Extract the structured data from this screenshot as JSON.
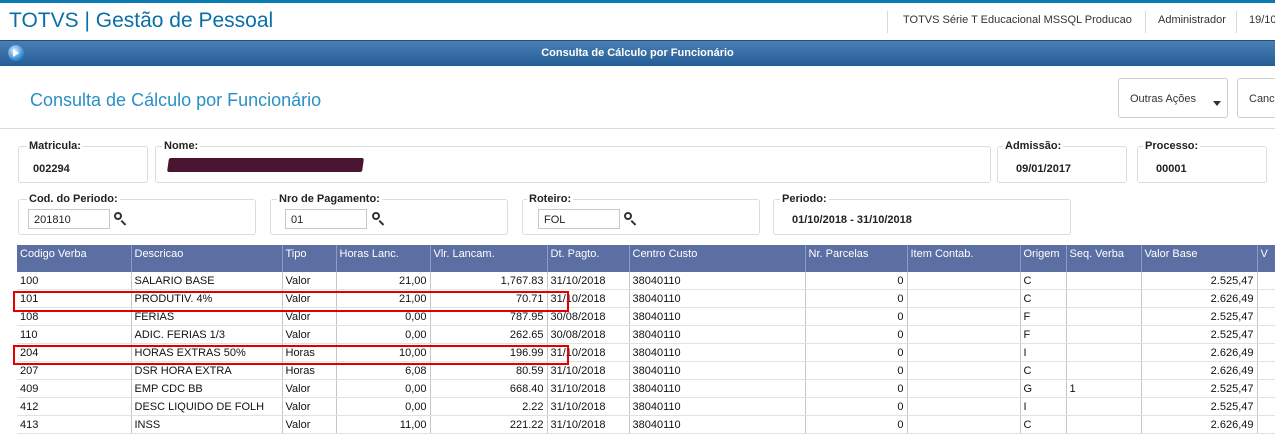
{
  "app": {
    "title": "TOTVS | Gestão de Pessoal",
    "environment": "TOTVS Série T Educacional MSSQL Producao",
    "user": "Administrador",
    "date": "19/10"
  },
  "window": {
    "title": "Consulta de Cálculo por Funcionário"
  },
  "page": {
    "title": "Consulta de Cálculo por Funcionário",
    "other_actions": "Outras Ações",
    "cancel": "Canc"
  },
  "fields": {
    "matricula": {
      "label": "Matricula:",
      "value": "002294"
    },
    "nome": {
      "label": "Nome:"
    },
    "admissao": {
      "label": "Admissão:",
      "value": "09/01/2017"
    },
    "processo": {
      "label": "Processo:",
      "value": "00001"
    },
    "cod_periodo": {
      "label": "Cod. do Periodo:",
      "value": "201810"
    },
    "nro_pagamento": {
      "label": "Nro de Pagamento:",
      "value": "01"
    },
    "roteiro": {
      "label": "Roteiro:",
      "value": "FOL"
    },
    "periodo": {
      "label": "Periodo:",
      "value": "01/10/2018 - 31/10/2018"
    }
  },
  "table": {
    "columns": [
      "Codigo Verba",
      "Descricao",
      "Tipo",
      "Horas Lanc.",
      "Vlr. Lancam.",
      "Dt. Pagto.",
      "Centro Custo",
      "Nr. Parcelas",
      "Item Contab.",
      "Origem",
      "Seq. Verba",
      "Valor Base",
      "V"
    ],
    "rows": [
      [
        "100",
        "SALARIO BASE",
        "Valor",
        "21,00",
        "1,767.83",
        "31/10/2018",
        "38040110",
        "0",
        "",
        "C",
        "",
        "2.525,47",
        ""
      ],
      [
        "101",
        "PRODUTIV. 4%",
        "Valor",
        "21,00",
        "70.71",
        "31/10/2018",
        "38040110",
        "0",
        "",
        "C",
        "",
        "2.626,49",
        ""
      ],
      [
        "108",
        "FERIAS",
        "Valor",
        "0,00",
        "787.95",
        "30/08/2018",
        "38040110",
        "0",
        "",
        "F",
        "",
        "2.525,47",
        ""
      ],
      [
        "110",
        "ADIC. FERIAS 1/3",
        "Valor",
        "0,00",
        "262.65",
        "30/08/2018",
        "38040110",
        "0",
        "",
        "F",
        "",
        "2.525,47",
        ""
      ],
      [
        "204",
        "HORAS EXTRAS 50%",
        "Horas",
        "10,00",
        "196.99",
        "31/10/2018",
        "38040110",
        "0",
        "",
        "I",
        "",
        "2.626,49",
        ""
      ],
      [
        "207",
        "DSR HORA EXTRA",
        "Horas",
        "6,08",
        "80.59",
        "31/10/2018",
        "38040110",
        "0",
        "",
        "C",
        "",
        "2.626,49",
        ""
      ],
      [
        "409",
        "EMP CDC BB",
        "Valor",
        "0,00",
        "668.40",
        "31/10/2018",
        "38040110",
        "0",
        "",
        "G",
        "1",
        "2.525,47",
        ""
      ],
      [
        "412",
        "DESC LIQUIDO DE FOLH",
        "Valor",
        "0,00",
        "2.22",
        "31/10/2018",
        "38040110",
        "0",
        "",
        "I",
        "",
        "2.525,47",
        ""
      ],
      [
        "413",
        "INSS",
        "Valor",
        "11,00",
        "221.22",
        "31/10/2018",
        "38040110",
        "0",
        "",
        "C",
        "",
        "2.626,49",
        ""
      ]
    ]
  },
  "colors": {
    "brand": "#0a6fa8",
    "header_bg": "#5c6fa3",
    "highlight": "#e00000"
  }
}
